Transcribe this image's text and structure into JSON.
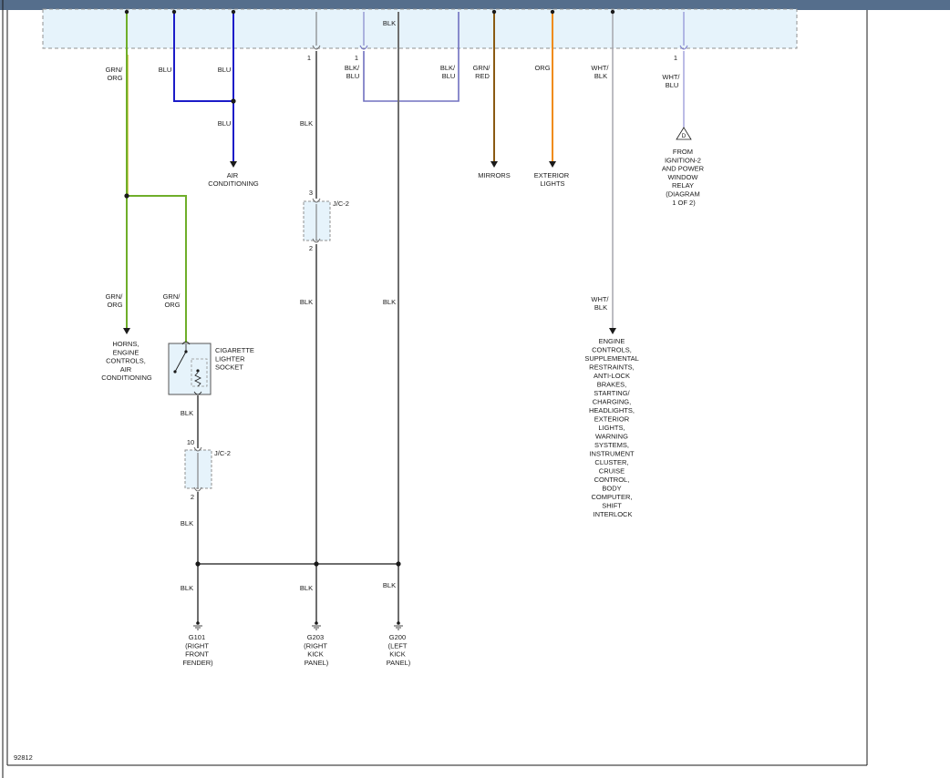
{
  "colors": {
    "top_bar": "#556e8c",
    "box_fill": "#e6f3fb",
    "box_stroke": "#909090",
    "frame": "#1a1a1a",
    "grn_org": "#6fae2a",
    "grn_org_yellow": "#cfc23a",
    "blu": "#1c1cc8",
    "blk": "#6e6e6e",
    "blk_blu": "#7070c0",
    "grn_red": "#8a5a12",
    "org": "#f08b10",
    "wht_blk": "#a0a0a8",
    "wht_blu": "#7a7acc"
  },
  "diagram_id": "92812",
  "wire_labels": {
    "grn_org_1": [
      "GRN/",
      "ORG"
    ],
    "blu_1": "BLU",
    "blu_2": "BLU",
    "blu_3": "BLU",
    "pin_1a": "1",
    "blk_top": "BLK",
    "blk_1": "BLK",
    "pin_1b": "1",
    "blk_blu_1": [
      "BLK/",
      "BLU"
    ],
    "blk_blu_2": [
      "BLK/",
      "BLU"
    ],
    "grn_red": [
      "GRN/",
      "RED"
    ],
    "org": "ORG",
    "wht_blk_1": [
      "WHT/",
      "BLK"
    ],
    "pin_1c": "1",
    "wht_blu": [
      "WHT/",
      "BLU"
    ],
    "grn_org_2": [
      "GRN/",
      "ORG"
    ],
    "grn_org_3": [
      "GRN/",
      "ORG"
    ],
    "blk_2": "BLK",
    "blk_3": "BLK",
    "wht_blk_2": [
      "WHT/",
      "BLK"
    ],
    "blk_4": "BLK",
    "blk_5": "BLK",
    "blk_6": "BLK",
    "blk_7": "BLK",
    "blk_8": "BLK"
  },
  "destinations": {
    "air_conditioning": [
      "AIR",
      "CONDITIONING"
    ],
    "mirrors": "MIRRORS",
    "exterior_lights": [
      "EXTERIOR",
      "LIGHTS"
    ],
    "from_ignition": [
      "FROM",
      "IGNITION-2",
      "AND POWER",
      "WINDOW",
      "RELAY",
      "(DIAGRAM",
      "1 OF 2)"
    ],
    "horns": [
      "HORNS,",
      "ENGINE",
      "CONTROLS,",
      "AIR",
      "CONDITIONING"
    ],
    "engine_controls": [
      "ENGINE",
      "CONTROLS,",
      "SUPPLEMENTAL",
      "RESTRAINTS,",
      "ANTI-LOCK",
      "BRAKES,",
      "STARTING/",
      "CHARGING,",
      "HEADLIGHTS,",
      "EXTERIOR",
      "LIGHTS,",
      "WARNING",
      "SYSTEMS,",
      "INSTRUMENT",
      "CLUSTER,",
      "CRUISE",
      "CONTROL,",
      "BODY",
      "COMPUTER,",
      "SHIFT",
      "INTERLOCK"
    ]
  },
  "connector_ref": "D",
  "components": {
    "cigarette_lighter": [
      "CIGARETTE",
      "LIGHTER",
      "SOCKET"
    ],
    "jc2_a": {
      "name": "J/C-2",
      "pin_top": "3",
      "pin_bottom": "2"
    },
    "jc2_b": {
      "name": "J/C-2",
      "pin_top": "10",
      "pin_bottom": "2"
    }
  },
  "grounds": {
    "g101": [
      "G101",
      "(RIGHT",
      "FRONT",
      "FENDER)"
    ],
    "g203": [
      "G203",
      "(RIGHT",
      "KICK",
      "PANEL)"
    ],
    "g200": [
      "G200",
      "(LEFT",
      "KICK",
      "PANEL)"
    ]
  }
}
